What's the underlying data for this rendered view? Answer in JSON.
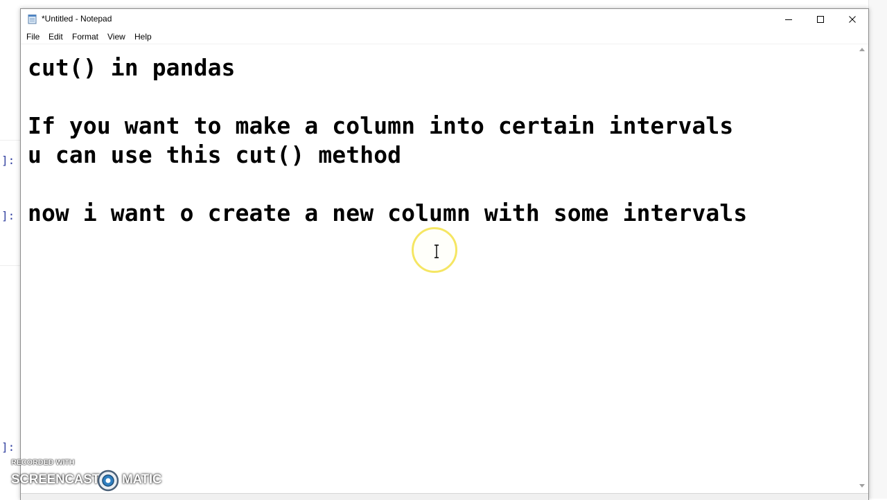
{
  "background": {
    "prompt_marker": "]:"
  },
  "window": {
    "title": "*Untitled - Notepad",
    "controls": {
      "minimize_icon": "minimize-icon",
      "maximize_icon": "maximize-icon",
      "close_icon": "close-icon"
    }
  },
  "menu": {
    "file": "File",
    "edit": "Edit",
    "format": "Format",
    "view": "View",
    "help": "Help"
  },
  "editor": {
    "lines": [
      "cut() in pandas",
      "",
      "If you want to make a column into certain intervals",
      "u can use this cut() method",
      "",
      "now i want o create a new column with some intervals"
    ]
  },
  "watermark": {
    "recorded_with": "RECORDED WITH",
    "brand_left": "SCREENCAST",
    "brand_right": "MATIC"
  },
  "colors": {
    "cursor_highlight": "#f5e663",
    "text": "#000000",
    "accent": "#303f9f"
  }
}
